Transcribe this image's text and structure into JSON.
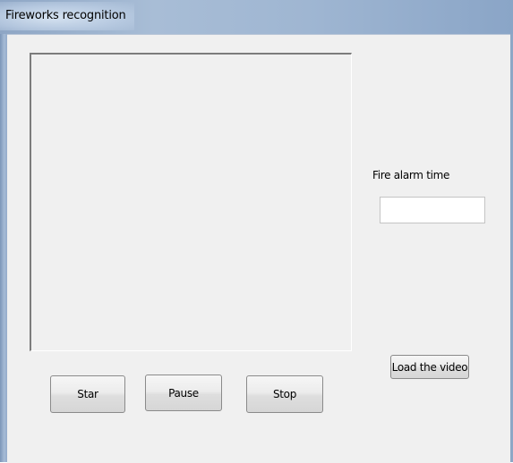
{
  "window": {
    "title": "Fireworks recognition"
  },
  "alarm": {
    "label": "Fire alarm time",
    "value": ""
  },
  "buttons": {
    "load_video": "Load the video",
    "start": "Star",
    "pause": "Pause",
    "stop": "Stop"
  }
}
